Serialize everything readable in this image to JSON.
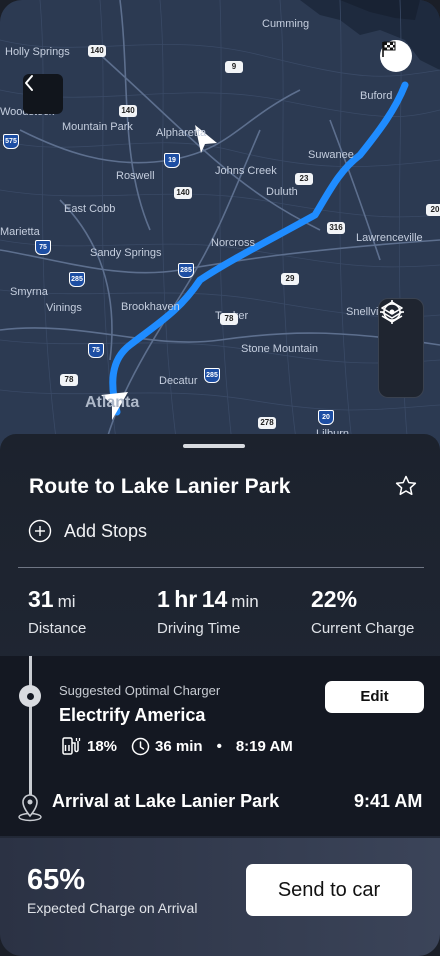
{
  "map": {
    "places": [
      "Cumming",
      "Holly Springs",
      "Buford",
      "Woodstock",
      "Mountain Park",
      "Alpharetta",
      "Roswell",
      "Johns Creek",
      "Suwanee",
      "Duluth",
      "East Cobb",
      "Marietta",
      "Sandy Springs",
      "Norcross",
      "Lawrenceville",
      "Smyrna",
      "Vinings",
      "Brookhaven",
      "Tucker",
      "Snellville",
      "Stone Mountain",
      "Decatur",
      "Atlanta",
      "Lilburn"
    ],
    "route_color": "#1f8cff",
    "back_icon": "chevron-left-icon",
    "destination_icon": "checkered-flag-icon",
    "layers_icon": "layers-icon",
    "locate_icon": "locate-icon"
  },
  "route": {
    "title": "Route to Lake Lanier Park",
    "favorite_icon": "star-icon",
    "add_stops_label": "Add Stops"
  },
  "stats": {
    "distance": {
      "value": "31",
      "unit": "mi",
      "label": "Distance"
    },
    "time": {
      "hours": "1",
      "hr_unit": "hr",
      "minutes": "14",
      "min_unit": "min",
      "label": "Driving Time"
    },
    "charge": {
      "value": "22%",
      "label": "Current Charge"
    }
  },
  "charger": {
    "label": "Suggested Optimal Charger",
    "name": "Electrify America",
    "charge_pct": "18%",
    "duration": "36 min",
    "separator": "•",
    "time": "8:19 AM",
    "edit_label": "Edit"
  },
  "arrival": {
    "label": "Arrival at Lake Lanier Park",
    "time": "9:41 AM"
  },
  "footer": {
    "expected_pct": "65%",
    "expected_label": "Expected Charge on Arrival",
    "send_label": "Send to car"
  }
}
